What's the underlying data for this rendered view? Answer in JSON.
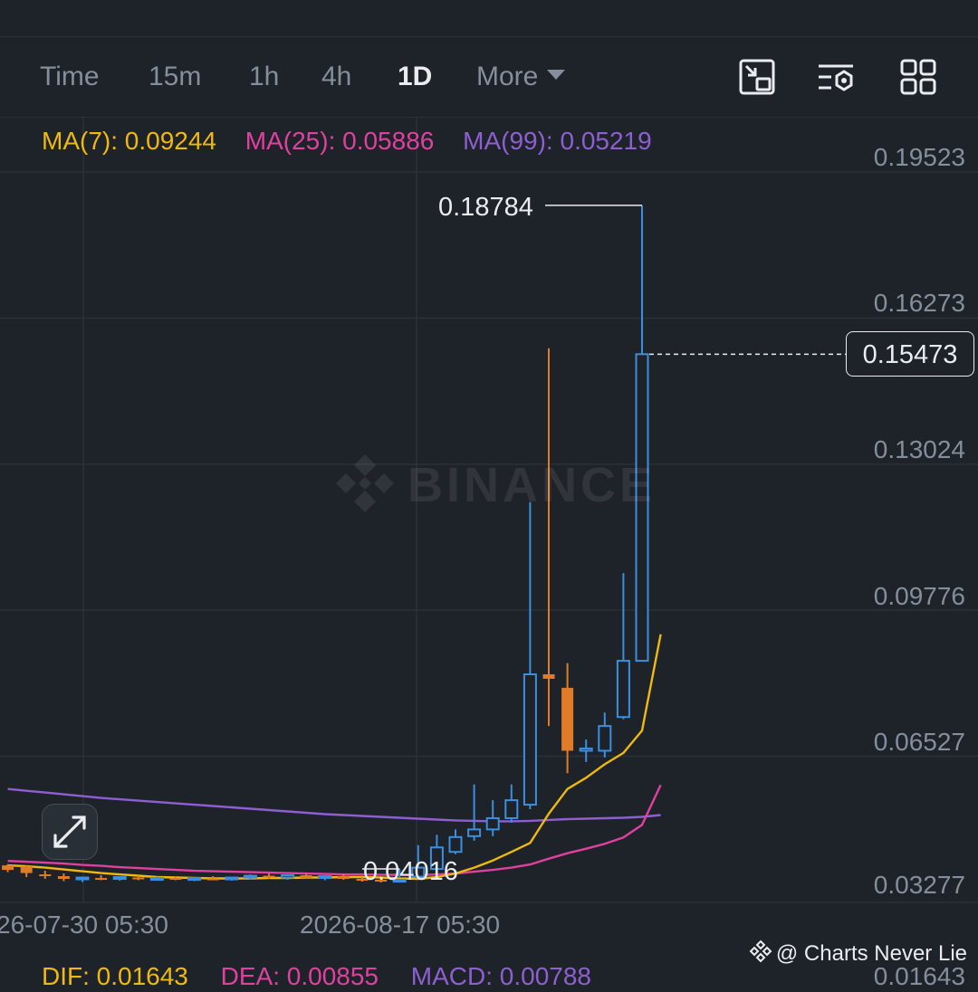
{
  "toolbar": {
    "intervals": [
      "Time",
      "15m",
      "1h",
      "4h",
      "1D"
    ],
    "active_interval": "1D",
    "more_label": "More",
    "icons": [
      "picture-in-picture-icon",
      "chart-settings-icon",
      "layout-grid-icon"
    ]
  },
  "ma_legend": {
    "ma7": "MA(7): 0.09244",
    "ma25": "MA(25): 0.05886",
    "ma99": "MA(99): 0.05219"
  },
  "price_axis": {
    "labels": [
      "0.19523",
      "0.16273",
      "0.13024",
      "0.09776",
      "0.06527",
      "0.03277"
    ],
    "current_price": "0.15473"
  },
  "markers": {
    "high": "0.18784",
    "low": "0.04016"
  },
  "time_axis": {
    "labels": [
      "26-07-30 05:30",
      "2026-08-17 05:30"
    ]
  },
  "watermark": {
    "text": "BINANCE"
  },
  "macd_legend": {
    "dif": "DIF: 0.01643",
    "dea": "DEA: 0.00855",
    "macd": "MACD: 0.00788",
    "axis": "0.01643"
  },
  "credit": {
    "text": "@ Charts Never Lie"
  },
  "colors": {
    "background": "#1e2329",
    "up": "#3b8fe0",
    "down": "#e07b28",
    "ma7": "#f0b90b",
    "ma25": "#e040a0",
    "ma99": "#8e5fd0",
    "grid": "#2b3139",
    "axis_text": "#848e9c"
  },
  "chart_data": {
    "type": "candlestick",
    "interval": "1D",
    "y_range": [
      0.03277,
      0.19523
    ],
    "candles": [
      {
        "o": 0.041,
        "h": 0.0415,
        "l": 0.04,
        "c": 0.0405
      },
      {
        "o": 0.041,
        "h": 0.0413,
        "l": 0.0395,
        "c": 0.04
      },
      {
        "o": 0.0408,
        "h": 0.041,
        "l": 0.0384,
        "c": 0.0393
      },
      {
        "o": 0.039,
        "h": 0.0398,
        "l": 0.038,
        "c": 0.0386
      },
      {
        "o": 0.0386,
        "h": 0.0392,
        "l": 0.0375,
        "c": 0.038
      },
      {
        "o": 0.038,
        "h": 0.0385,
        "l": 0.0373,
        "c": 0.0383
      },
      {
        "o": 0.0382,
        "h": 0.0388,
        "l": 0.0377,
        "c": 0.038
      },
      {
        "o": 0.038,
        "h": 0.0386,
        "l": 0.0376,
        "c": 0.0384
      },
      {
        "o": 0.0383,
        "h": 0.0387,
        "l": 0.0377,
        "c": 0.0379
      },
      {
        "o": 0.0379,
        "h": 0.0385,
        "l": 0.0376,
        "c": 0.0382
      },
      {
        "o": 0.0382,
        "h": 0.0386,
        "l": 0.0377,
        "c": 0.0378
      },
      {
        "o": 0.0378,
        "h": 0.0384,
        "l": 0.0375,
        "c": 0.0382
      },
      {
        "o": 0.0381,
        "h": 0.0386,
        "l": 0.0377,
        "c": 0.0379
      },
      {
        "o": 0.0379,
        "h": 0.0384,
        "l": 0.0376,
        "c": 0.0383
      },
      {
        "o": 0.0383,
        "h": 0.039,
        "l": 0.0378,
        "c": 0.0387
      },
      {
        "o": 0.0387,
        "h": 0.0392,
        "l": 0.038,
        "c": 0.0383
      },
      {
        "o": 0.0383,
        "h": 0.039,
        "l": 0.0378,
        "c": 0.0388
      },
      {
        "o": 0.0388,
        "h": 0.0392,
        "l": 0.038,
        "c": 0.0382
      },
      {
        "o": 0.0382,
        "h": 0.0388,
        "l": 0.0377,
        "c": 0.0386
      },
      {
        "o": 0.0386,
        "h": 0.039,
        "l": 0.0378,
        "c": 0.038
      },
      {
        "o": 0.038,
        "h": 0.0384,
        "l": 0.0374,
        "c": 0.0378
      },
      {
        "o": 0.0378,
        "h": 0.0382,
        "l": 0.0372,
        "c": 0.0375
      },
      {
        "o": 0.0375,
        "h": 0.0382,
        "l": 0.0402,
        "c": 0.0378
      },
      {
        "o": 0.0385,
        "h": 0.0455,
        "l": 0.038,
        "c": 0.0405
      },
      {
        "o": 0.0402,
        "h": 0.0478,
        "l": 0.0398,
        "c": 0.045
      },
      {
        "o": 0.044,
        "h": 0.049,
        "l": 0.0435,
        "c": 0.0473
      },
      {
        "o": 0.0475,
        "h": 0.059,
        "l": 0.0465,
        "c": 0.049
      },
      {
        "o": 0.049,
        "h": 0.0555,
        "l": 0.0475,
        "c": 0.0515
      },
      {
        "o": 0.0515,
        "h": 0.059,
        "l": 0.0505,
        "c": 0.0555
      },
      {
        "o": 0.0545,
        "h": 0.1218,
        "l": 0.0535,
        "c": 0.0835
      },
      {
        "o": 0.0835,
        "h": 0.156,
        "l": 0.072,
        "c": 0.0825
      },
      {
        "o": 0.0805,
        "h": 0.086,
        "l": 0.0615,
        "c": 0.0665
      },
      {
        "o": 0.0665,
        "h": 0.069,
        "l": 0.064,
        "c": 0.067
      },
      {
        "o": 0.0665,
        "h": 0.075,
        "l": 0.065,
        "c": 0.072
      },
      {
        "o": 0.074,
        "h": 0.106,
        "l": 0.0735,
        "c": 0.0865
      },
      {
        "o": 0.0865,
        "h": 0.1878,
        "l": 0.0865,
        "c": 0.1547
      }
    ],
    "ma7": [
      0.041,
      0.0408,
      0.0405,
      0.0401,
      0.0397,
      0.0393,
      0.039,
      0.0387,
      0.0384,
      0.0383,
      0.0382,
      0.0381,
      0.0381,
      0.0381,
      0.0382,
      0.0382,
      0.0383,
      0.0383,
      0.0384,
      0.0384,
      0.0383,
      0.0381,
      0.038,
      0.0384,
      0.0392,
      0.0405,
      0.0421,
      0.044,
      0.046,
      0.0525,
      0.058,
      0.0605,
      0.0635,
      0.066,
      0.071,
      0.0924
    ],
    "ma25": [
      0.042,
      0.0418,
      0.0416,
      0.0414,
      0.0411,
      0.0409,
      0.0406,
      0.0404,
      0.0402,
      0.04,
      0.0398,
      0.0397,
      0.0396,
      0.0395,
      0.0394,
      0.0393,
      0.0392,
      0.0391,
      0.039,
      0.039,
      0.0389,
      0.0389,
      0.0388,
      0.039,
      0.0392,
      0.0396,
      0.04,
      0.0405,
      0.0412,
      0.0425,
      0.0437,
      0.0447,
      0.0458,
      0.0472,
      0.05,
      0.0589
    ],
    "ma99": [
      0.058,
      0.0576,
      0.0572,
      0.0568,
      0.0564,
      0.056,
      0.0557,
      0.0554,
      0.0551,
      0.0548,
      0.0545,
      0.0542,
      0.0539,
      0.0536,
      0.0533,
      0.053,
      0.0527,
      0.0524,
      0.0522,
      0.052,
      0.0518,
      0.0516,
      0.0514,
      0.0512,
      0.051,
      0.0509,
      0.0508,
      0.0508,
      0.0509,
      0.0511,
      0.0513,
      0.0514,
      0.0515,
      0.0516,
      0.0518,
      0.0522
    ]
  }
}
